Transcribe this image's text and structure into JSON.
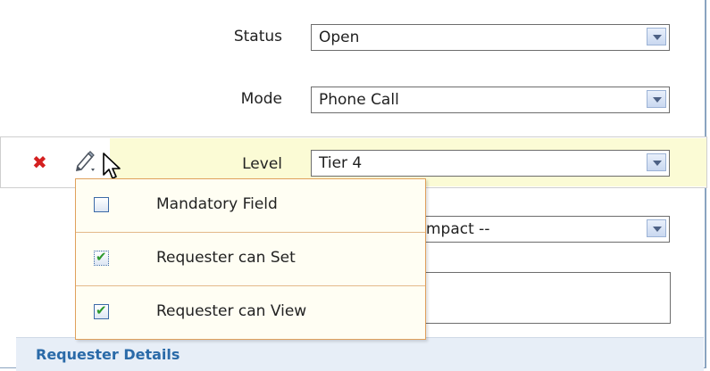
{
  "form": {
    "status": {
      "label": "Status",
      "value": "Open"
    },
    "mode": {
      "label": "Mode",
      "value": "Phone Call"
    },
    "level": {
      "label": "Level",
      "value": "Tier 4"
    },
    "impact": {
      "value_partial": "mpact --"
    }
  },
  "field_actions": {
    "delete_icon": "close-x-icon",
    "edit_icon": "pencil-icon"
  },
  "popup_menu": {
    "items": [
      {
        "label": "Mandatory Field",
        "checked": false
      },
      {
        "label": "Requester can Set",
        "checked": true
      },
      {
        "label": "Requester can View",
        "checked": true
      }
    ]
  },
  "section": {
    "title": "Requester Details"
  },
  "colors": {
    "highlight": "#fbfbd5",
    "popup_border": "#e0a15c",
    "section_header_text": "#2a6aa8",
    "check_green": "#2e9a2e"
  }
}
